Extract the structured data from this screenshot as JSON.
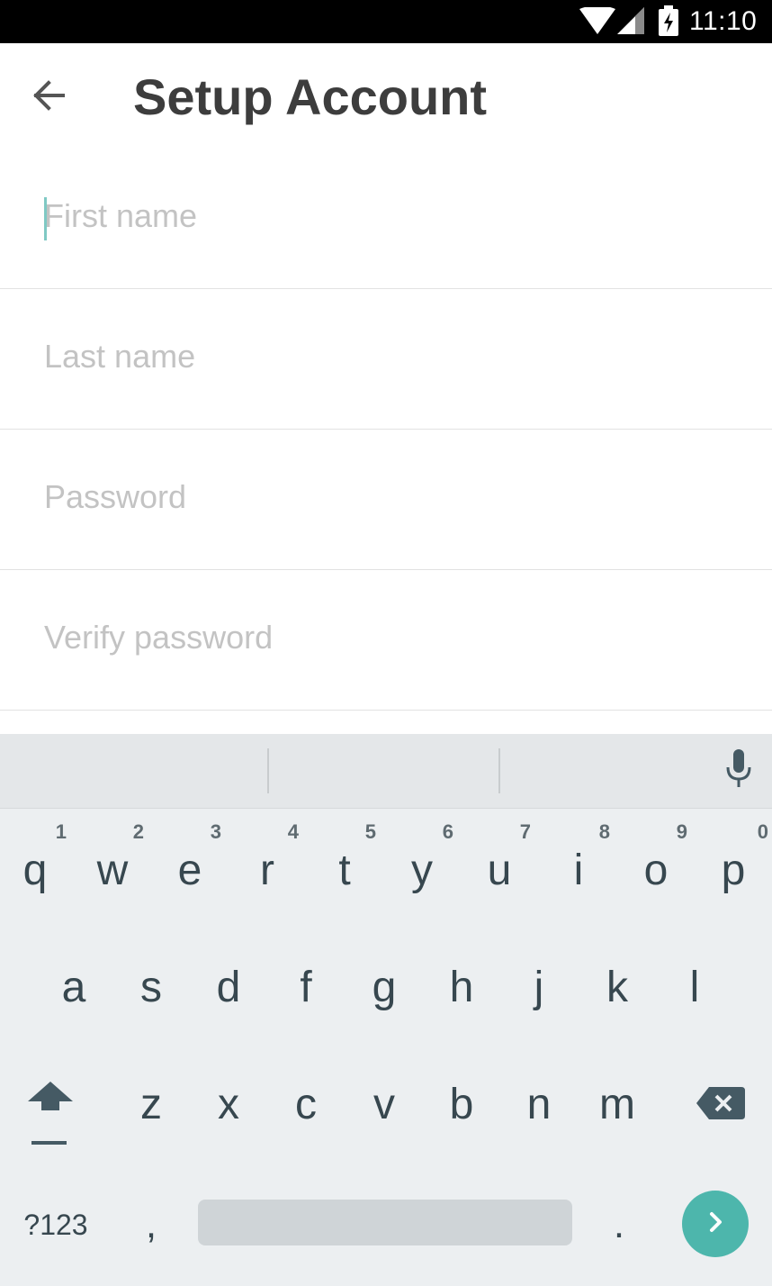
{
  "status_bar": {
    "time": "11:10",
    "icons": [
      "wifi-icon",
      "signal-icon",
      "battery-charging-icon"
    ]
  },
  "app_bar": {
    "back_icon": "arrow-left-icon",
    "title": "Setup Account"
  },
  "form": {
    "fields": [
      {
        "placeholder": "First name",
        "value": "",
        "focused": true
      },
      {
        "placeholder": "Last name",
        "value": ""
      },
      {
        "placeholder": "Password",
        "value": ""
      },
      {
        "placeholder": "Verify password",
        "value": ""
      }
    ]
  },
  "keyboard": {
    "row1": [
      {
        "letter": "q",
        "hint": "1"
      },
      {
        "letter": "w",
        "hint": "2"
      },
      {
        "letter": "e",
        "hint": "3"
      },
      {
        "letter": "r",
        "hint": "4"
      },
      {
        "letter": "t",
        "hint": "5"
      },
      {
        "letter": "y",
        "hint": "6"
      },
      {
        "letter": "u",
        "hint": "7"
      },
      {
        "letter": "i",
        "hint": "8"
      },
      {
        "letter": "o",
        "hint": "9"
      },
      {
        "letter": "p",
        "hint": "0"
      }
    ],
    "row2": [
      "a",
      "s",
      "d",
      "f",
      "g",
      "h",
      "j",
      "k",
      "l"
    ],
    "row3": [
      "z",
      "x",
      "c",
      "v",
      "b",
      "n",
      "m"
    ],
    "symbols_label": "?123",
    "comma_label": ",",
    "period_label": ".",
    "icons": {
      "mic": "microphone-icon",
      "shift": "shift-icon",
      "backspace": "backspace-icon",
      "enter": "chevron-right-icon"
    },
    "colors": {
      "accent": "#4db6ac",
      "background": "#eceff1",
      "key_text": "#37474f"
    }
  }
}
